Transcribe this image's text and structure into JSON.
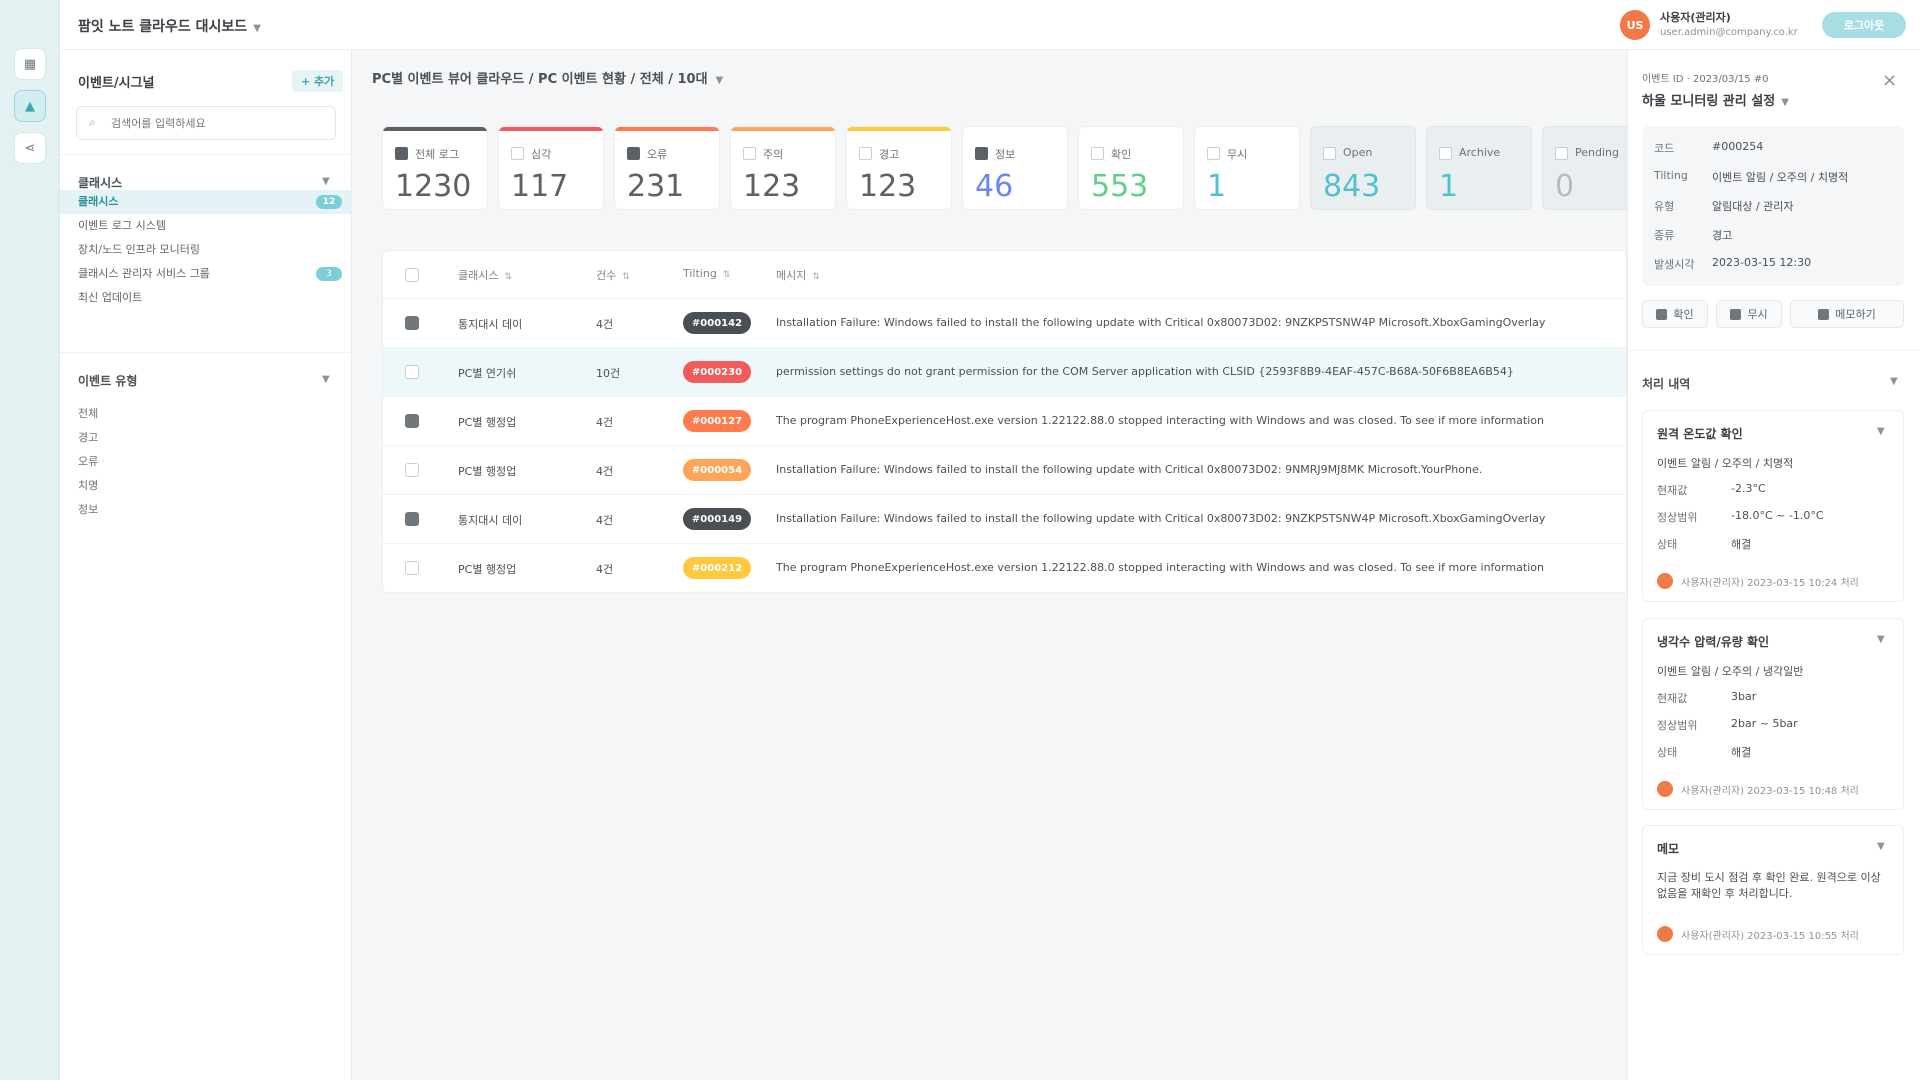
{
  "colors": {
    "accent": "#3aa6b3",
    "black": "#4a4f55",
    "red": "#f15b5b",
    "orange_red": "#ff7a4d",
    "orange": "#ffa559",
    "yellow": "#ffc83d",
    "blue": "#6b86f5",
    "green": "#5fd08a",
    "teal": "#4fc2ce"
  },
  "topbar": {
    "title": "팜잇 노트 클라우드 대시보드",
    "user_avatar": "US",
    "user_name": "사용자(관리자)",
    "user_email": "user.admin@company.co.kr",
    "action_label": "로그아웃"
  },
  "rail": {
    "items": [
      "home-icon",
      "alert-icon",
      "share-icon"
    ]
  },
  "left": {
    "title": "이벤트/시그널",
    "add_label": "+ 추가",
    "search_placeholder": "검색어를 입력하세요",
    "section1": "클래시스",
    "items": [
      {
        "label": "클래시스",
        "badge": "12",
        "active": true
      },
      {
        "label": "이벤트 로그 시스템",
        "badge": "",
        "active": false
      },
      {
        "label": "장치/노드 인프라 모니터링",
        "badge": "",
        "active": false
      },
      {
        "label": "클래시스 관리자 서비스 그룹",
        "badge": "3",
        "active": false
      },
      {
        "label": "최신 업데이트",
        "badge": "",
        "active": false
      }
    ],
    "section2": "이벤트 유형",
    "subitems": [
      "전체",
      "경고",
      "오류",
      "치명",
      "정보"
    ]
  },
  "main": {
    "breadcrumb": "PC별 이벤트 뷰어 클라우드 / PC 이벤트 현황 / 전체 / 10대",
    "tiles": [
      {
        "label": "전체 로그",
        "value": "1230",
        "color": "#5b6166",
        "checked": true
      },
      {
        "label": "심각",
        "value": "117",
        "color": "#f15b5b",
        "checked": false
      },
      {
        "label": "오류",
        "value": "231",
        "color": "#ff7a4d",
        "checked": true
      },
      {
        "label": "주의",
        "value": "123",
        "color": "#ffa559",
        "checked": false
      },
      {
        "label": "경고",
        "value": "123",
        "color": "#ffc83d",
        "checked": false
      },
      {
        "label": "정보",
        "value": "46",
        "color": "#6b86f5",
        "checked": true
      },
      {
        "label": "확인",
        "value": "553",
        "color": "#5fd08a",
        "checked": false
      },
      {
        "label": "무시",
        "value": "1",
        "color": "#4fc2ce",
        "checked": false
      },
      {
        "label": "Open",
        "value": "843",
        "color": "#4fc2ce",
        "checked": false
      },
      {
        "label": "Archive",
        "value": "1",
        "color": "#4fc2ce",
        "checked": false
      },
      {
        "label": "Pending",
        "value": "0",
        "color": "#b4bcc0",
        "checked": false
      }
    ],
    "columns": {
      "name": "클래시스",
      "count": "건수",
      "tag": "Tilting",
      "message": "메시지"
    },
    "rows": [
      {
        "name": "통지대시 데이",
        "count": "4건",
        "tag": "#000142",
        "tag_color": "#4a4f55",
        "checked": true,
        "selected": false,
        "message": "Installation Failure: Windows failed to install the following update with Critical 0x80073D02: 9NZKPSTSNW4P Microsoft.XboxGamingOverlay"
      },
      {
        "name": "PC별 연기쉬",
        "count": "10건",
        "tag": "#000230",
        "tag_color": "#f15b5b",
        "checked": false,
        "selected": true,
        "message": "permission settings do not grant permission for the COM Server application with CLSID {2593F8B9-4EAF-457C-B68A-50F6B8EA6B54}"
      },
      {
        "name": "PC별 행정업",
        "count": "4건",
        "tag": "#000127",
        "tag_color": "#ff7a4d",
        "checked": true,
        "selected": false,
        "message": "The program PhoneExperienceHost.exe version 1.22122.88.0 stopped interacting with Windows and was closed. To see if more information"
      },
      {
        "name": "PC별 행정업",
        "count": "4건",
        "tag": "#000054",
        "tag_color": "#ffa559",
        "checked": false,
        "selected": false,
        "message": "Installation Failure: Windows failed to install the following update with Critical 0x80073D02: 9NMRJ9MJ8MK Microsoft.YourPhone."
      },
      {
        "name": "통지대시 데이",
        "count": "4건",
        "tag": "#000149",
        "tag_color": "#4a4f55",
        "checked": true,
        "selected": false,
        "message": "Installation Failure: Windows failed to install the following update with Critical 0x80073D02: 9NZKPSTSNW4P Microsoft.XboxGamingOverlay"
      },
      {
        "name": "PC별 행정업",
        "count": "4건",
        "tag": "#000212",
        "tag_color": "#ffc83d",
        "checked": false,
        "selected": false,
        "message": "The program PhoneExperienceHost.exe version 1.22122.88.0 stopped interacting with Windows and was closed. To see if more information"
      }
    ]
  },
  "right": {
    "subtitle": "이벤트 ID · 2023/03/15 #0",
    "title": "하울 모니터링 관리 설정",
    "info": [
      {
        "k": "코드",
        "v": "#000254"
      },
      {
        "k": "Tilting",
        "v": "이벤트 알림 / 오주의 / 치명적"
      },
      {
        "k": "유형",
        "v": "알림대상 / 관리자"
      },
      {
        "k": "종류",
        "v": "경고"
      },
      {
        "k": "발생시각",
        "v": "2023-03-15 12:30"
      }
    ],
    "buttons": [
      "확인",
      "무시",
      "메모하기"
    ],
    "activity_title": "처리 내역",
    "activities": [
      {
        "title": "원격 온도값 확인",
        "line": "이벤트 알림 / 오주의 / 치명적",
        "rows": [
          {
            "k": "현재값",
            "v": "-2.3°C"
          },
          {
            "k": "정상범위",
            "v": "-18.0°C ~ -1.0°C"
          },
          {
            "k": "상태",
            "v": "해결"
          }
        ],
        "footer": "사용자(관리자) 2023-03-15 10:24 처리"
      },
      {
        "title": "냉각수 압력/유량 확인",
        "line": "이벤트 알림 / 오주의 / 냉각일반",
        "rows": [
          {
            "k": "현재값",
            "v": "3bar"
          },
          {
            "k": "정상범위",
            "v": "2bar ~ 5bar"
          },
          {
            "k": "상태",
            "v": "해결"
          }
        ],
        "footer": "사용자(관리자) 2023-03-15 10:48 처리"
      },
      {
        "title": "메모",
        "desc": "지금 장비 도시 점검 후 확인 완료. 원격으로 이상 없음을 재확인 후 처리합니다.",
        "footer": "사용자(관리자) 2023-03-15 10:55 처리"
      }
    ]
  }
}
